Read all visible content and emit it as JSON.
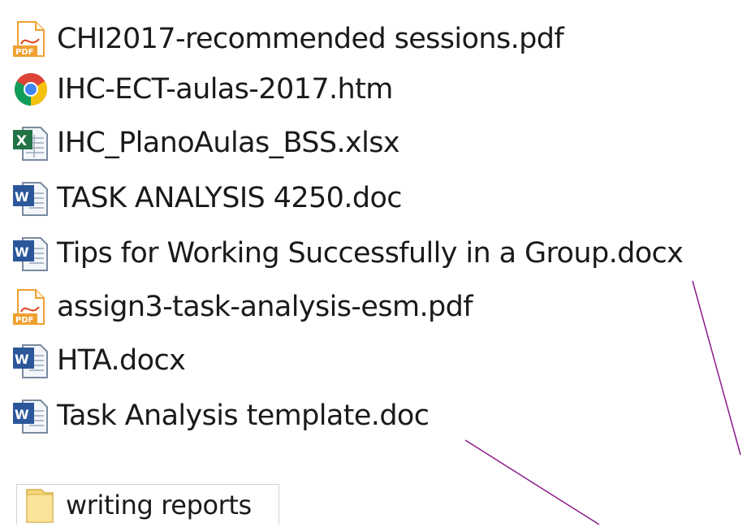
{
  "files": [
    {
      "name": "CHI2017-recommended sessions.pdf",
      "icon": "pdf-icon"
    },
    {
      "name": "IHC-ECT-aulas-2017.htm",
      "icon": "chrome-icon"
    },
    {
      "name": "IHC_PlanoAulas_BSS.xlsx",
      "icon": "excel-icon"
    },
    {
      "name": "TASK ANALYSIS 4250.doc",
      "icon": "word-icon"
    },
    {
      "name": "Tips for Working Successfully in a Group.docx",
      "icon": "word-icon"
    },
    {
      "name": "assign3-task-analysis-esm.pdf",
      "icon": "pdf-icon"
    },
    {
      "name": "HTA.docx",
      "icon": "word-icon"
    },
    {
      "name": "Task Analysis template.doc",
      "icon": "word-icon"
    }
  ],
  "folder": {
    "name": "writing reports",
    "icon": "folder-icon"
  },
  "colors": {
    "annotation_line": "#8b1a8b",
    "pdf_orange": "#f0a030",
    "word_blue": "#2b579a",
    "excel_green": "#217346",
    "folder_yellow": "#f5d677"
  }
}
